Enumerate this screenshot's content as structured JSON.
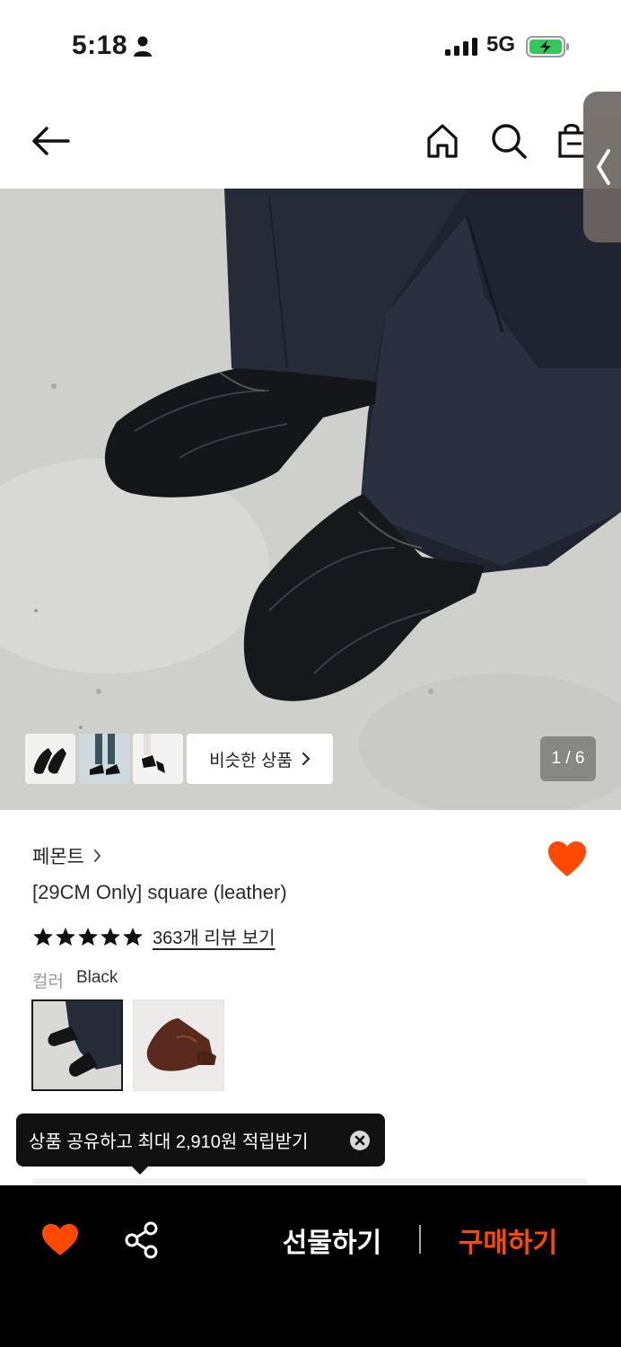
{
  "status_bar": {
    "time": "5:18",
    "network": "5G"
  },
  "gallery": {
    "similar_label": "비슷한 상품",
    "counter": "1 / 6"
  },
  "product": {
    "brand": "페몬트",
    "title": "[29CM Only] square (leather)",
    "rating_stars": 5,
    "review_link": "363개 리뷰 보기",
    "color_label": "컬러",
    "color_value": "Black"
  },
  "tooltip": {
    "text": "상품 공유하고 최대 2,910원 적립받기"
  },
  "bottom_bar": {
    "gift_label": "선물하기",
    "buy_label": "구매하기"
  },
  "colors": {
    "accent": "#ff4800",
    "bottom_bar_bg": "#000000"
  },
  "icons": [
    "back-arrow-icon",
    "home-icon",
    "search-icon",
    "shopping-bag-icon",
    "chevron-left-icon",
    "chevron-right-icon",
    "heart-icon",
    "star-icon",
    "close-icon",
    "share-icon"
  ]
}
